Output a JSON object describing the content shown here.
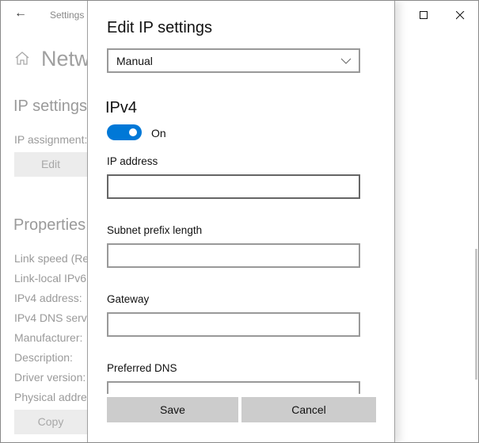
{
  "window": {
    "title": "Settings",
    "controls": {
      "minimize": "minimize-icon",
      "maximize": "maximize-icon",
      "close": "close-icon"
    }
  },
  "background": {
    "page_title": "Netw",
    "ip_settings_heading": "IP settings",
    "ip_assignment_label": "IP assignment:",
    "edit_button": "Edit",
    "properties_heading": "Properties",
    "properties": [
      "Link speed (Re",
      "Link-local IPv6",
      "IPv4 address:",
      "IPv4 DNS serve",
      "Manufacturer:",
      "Description:",
      "Driver version:",
      "Physical addres"
    ],
    "copy_button": "Copy"
  },
  "dialog": {
    "title": "Edit IP settings",
    "mode_select": {
      "selected": "Manual"
    },
    "ipv4_heading": "IPv4",
    "ipv4_toggle": {
      "state": "On",
      "on": true,
      "color": "#0078d7"
    },
    "fields": [
      {
        "label": "IP address",
        "value": ""
      },
      {
        "label": "Subnet prefix length",
        "value": ""
      },
      {
        "label": "Gateway",
        "value": ""
      },
      {
        "label": "Preferred DNS",
        "value": ""
      }
    ],
    "save_button": "Save",
    "cancel_button": "Cancel"
  }
}
